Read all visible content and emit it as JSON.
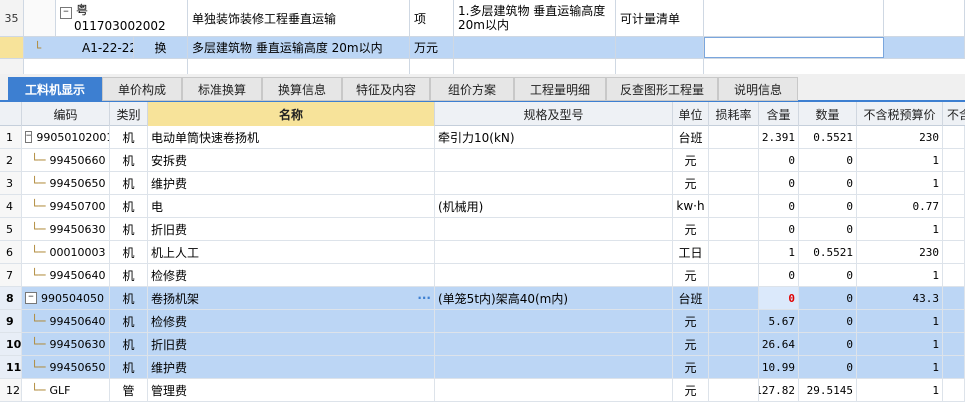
{
  "bill_rows": [
    {
      "row_num": "35",
      "code_top": "粤",
      "code": "011703002002",
      "name": "单独装饰装修工程垂直运输",
      "unit": "项",
      "feature_1": "1.多层建筑物 垂直运输高度",
      "feature_2": "20m以内",
      "measure_type": "可计量清单"
    },
    {
      "code": "A1-22-22",
      "replace_mark": "换",
      "name": "多层建筑物 垂直运输高度 20m以内",
      "unit": "万元"
    }
  ],
  "tabs": [
    "工料机显示",
    "单价构成",
    "标准换算",
    "换算信息",
    "特征及内容",
    "组价方案",
    "工程量明细",
    "反查图形工程量",
    "说明信息"
  ],
  "active_tab": 0,
  "columns": [
    "编码",
    "类别",
    "名称",
    "规格及型号",
    "单位",
    "损耗率",
    "含量",
    "数量",
    "不含税预算价",
    "不含"
  ],
  "rows": [
    {
      "n": "1",
      "code": "99050102001",
      "toggle": "−",
      "cat": "机",
      "name": "电动单筒快速卷扬机",
      "spec": "牵引力10(kN)",
      "unit": "台班",
      "loss": "",
      "content": "2.391",
      "qty": "0.5521",
      "price": "230"
    },
    {
      "n": "2",
      "code": "99450660",
      "cat": "机",
      "name": "安拆费",
      "spec": "",
      "unit": "元",
      "loss": "",
      "content": "0",
      "qty": "0",
      "price": "1"
    },
    {
      "n": "3",
      "code": "99450650",
      "cat": "机",
      "name": "维护费",
      "spec": "",
      "unit": "元",
      "loss": "",
      "content": "0",
      "qty": "0",
      "price": "1"
    },
    {
      "n": "4",
      "code": "99450700",
      "cat": "机",
      "name": "电",
      "spec": "(机械用)",
      "unit": "kw·h",
      "loss": "",
      "content": "0",
      "qty": "0",
      "price": "0.77"
    },
    {
      "n": "5",
      "code": "99450630",
      "cat": "机",
      "name": "折旧费",
      "spec": "",
      "unit": "元",
      "loss": "",
      "content": "0",
      "qty": "0",
      "price": "1"
    },
    {
      "n": "6",
      "code": "00010003",
      "cat": "机",
      "name": "机上人工",
      "spec": "",
      "unit": "工日",
      "loss": "",
      "content": "1",
      "qty": "0.5521",
      "price": "230"
    },
    {
      "n": "7",
      "code": "99450640",
      "cat": "机",
      "name": "检修费",
      "spec": "",
      "unit": "元",
      "loss": "",
      "content": "0",
      "qty": "0",
      "price": "1"
    },
    {
      "n": "8",
      "code": "990504050",
      "toggle": "−",
      "cat": "机",
      "name": "卷扬机架",
      "spec": "(单笼5t内)架高40(m内)",
      "unit": "台班",
      "loss": "",
      "content": "0",
      "qty": "0",
      "price": "43.3",
      "more": "···"
    },
    {
      "n": "9",
      "code": "99450640",
      "cat": "机",
      "name": "检修费",
      "spec": "",
      "unit": "元",
      "loss": "",
      "content": "5.67",
      "qty": "0",
      "price": "1"
    },
    {
      "n": "10",
      "code": "99450630",
      "cat": "机",
      "name": "折旧费",
      "spec": "",
      "unit": "元",
      "loss": "",
      "content": "26.64",
      "qty": "0",
      "price": "1"
    },
    {
      "n": "11",
      "code": "99450650",
      "cat": "机",
      "name": "维护费",
      "spec": "",
      "unit": "元",
      "loss": "",
      "content": "10.99",
      "qty": "0",
      "price": "1"
    },
    {
      "n": "12",
      "code": "GLF",
      "cat": "管",
      "name": "管理费",
      "spec": "",
      "unit": "元",
      "loss": "",
      "content": "127.82",
      "qty": "29.5145",
      "price": "1"
    }
  ],
  "colors": {
    "accent": "#3d7fd1",
    "selection": "#bcd6f5",
    "header_highlight": "#f7e39a",
    "alert": "#e00000"
  }
}
